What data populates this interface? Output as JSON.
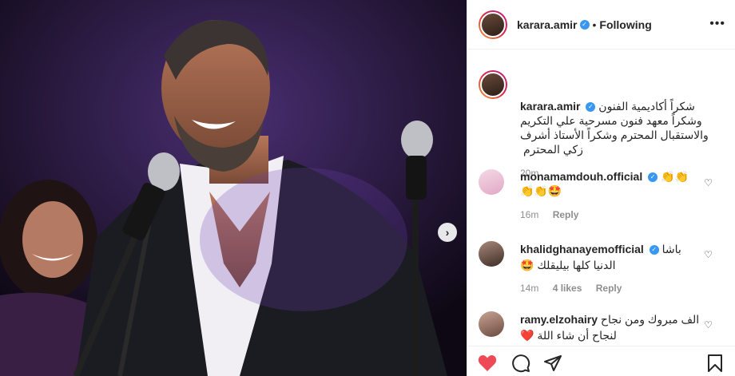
{
  "post": {
    "author": "karara.amir",
    "follow_state": "Following",
    "dot": "•",
    "more_glyph": "•••",
    "caption": "شكراً أكاديمية الفنون وشكراً معهد فنون مسرحية علي التكريم والاستقبال المحترم وشكراً الأستاذ أشرف زكي المحترم",
    "caption_time": "20m"
  },
  "comments": [
    {
      "user": "monamamdouh.official",
      "text": "👏👏👏👏🤩",
      "time": "16m",
      "likes": "",
      "reply": "Reply"
    },
    {
      "user": "khalidghanayemofficial",
      "text": "باشا الدنيا كلها بيليقلك 🤩",
      "time": "14m",
      "likes": "4 likes",
      "reply": "Reply"
    },
    {
      "user": "ramy.elzohairy",
      "text": "الف مبروك ومن نجاح لنجاح أن شاء اللة ❤️",
      "time": "",
      "likes": "",
      "reply": ""
    }
  ],
  "icons": {
    "like": "heart-filled-icon",
    "comment": "comment-icon",
    "share": "paper-plane-icon",
    "save": "bookmark-icon",
    "next": "chevron-right-icon",
    "verified": "verified-badge-icon"
  },
  "colors": {
    "like_red": "#ed4956",
    "verified_blue": "#3897f0",
    "muted": "#8e8e8e"
  }
}
